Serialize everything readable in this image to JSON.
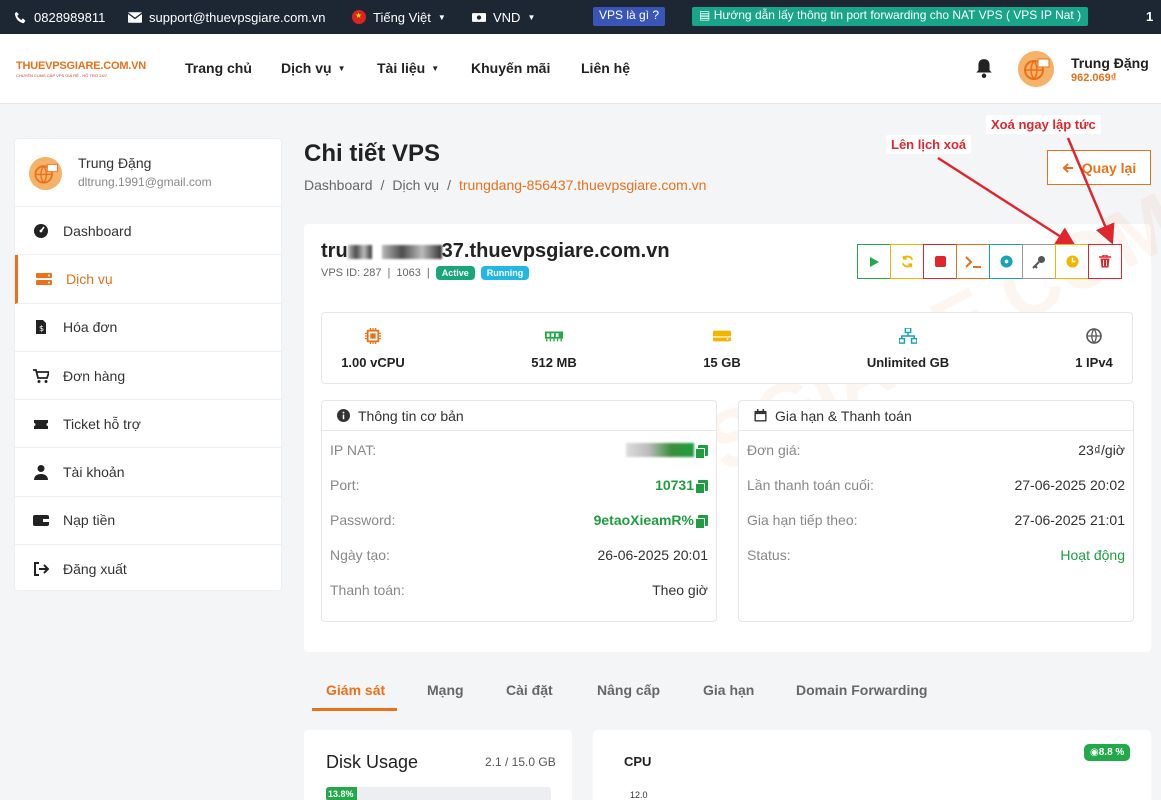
{
  "topbar": {
    "phone": "0828989811",
    "email": "support@thuevpsgiare.com.vn",
    "language": "Tiếng Việt",
    "currency": "VND",
    "vps_link": "VPS là gì ?",
    "guide_link": "Hướng dẫn lấy thông tin port forwarding cho NAT VPS ( VPS IP Nat )",
    "trailing": "1"
  },
  "header": {
    "logo_text": "THUEVPSGIARE.COM.VN",
    "logo_tagline": "CHUYÊN CUNG CẤP VPS GIÁ RẺ - HỖ TRỢ 24/7",
    "nav": [
      "Trang chủ",
      "Dịch vụ",
      "Tài liệu",
      "Khuyến mãi",
      "Liên hệ"
    ],
    "user_name": "Trung Đặng",
    "user_balance": "962.069₫"
  },
  "sidebar": {
    "user_name": "Trung Đặng",
    "user_email": "dltrung.1991@gmail.com",
    "items": [
      {
        "label": "Dashboard",
        "icon": "dashboard-icon"
      },
      {
        "label": "Dịch vụ",
        "icon": "server-icon"
      },
      {
        "label": "Hóa đơn",
        "icon": "invoice-icon"
      },
      {
        "label": "Đơn hàng",
        "icon": "cart-icon"
      },
      {
        "label": "Ticket hỗ trợ",
        "icon": "ticket-icon"
      },
      {
        "label": "Tài khoản",
        "icon": "user-icon"
      },
      {
        "label": "Nạp tiền",
        "icon": "wallet-icon"
      },
      {
        "label": "Đăng xuất",
        "icon": "logout-icon"
      }
    ],
    "active_index": 1
  },
  "page": {
    "title": "Chi tiết VPS",
    "breadcrumb": [
      "Dashboard",
      "Dịch vụ",
      "trungdang-856437.thuevpsgiare.com.vn"
    ],
    "back_label": "Quay lại",
    "annotation_schedule": "Lên lịch xoá",
    "annotation_delete": "Xoá ngay lập tức"
  },
  "vps": {
    "host_visible_start": "tru",
    "host_visible_end": "37.thuevpsgiare.com.vn",
    "vps_id": "VPS ID: 287",
    "plan_id": "1063",
    "status_active": "Active",
    "status_running": "Running",
    "actions": [
      {
        "name": "start",
        "icon": "play-icon",
        "color": "#22a94a"
      },
      {
        "name": "restart",
        "icon": "refresh-icon",
        "color": "#f2b600"
      },
      {
        "name": "stop",
        "icon": "stop-icon",
        "color": "#e0262d"
      },
      {
        "name": "console",
        "icon": "terminal-icon",
        "color": "#e8711a"
      },
      {
        "name": "reinstall",
        "icon": "disc-icon",
        "color": "#17a2b8"
      },
      {
        "name": "password",
        "icon": "key-icon",
        "color": "#555555"
      },
      {
        "name": "schedule-delete",
        "icon": "clock-icon",
        "color": "#f2b600"
      },
      {
        "name": "delete",
        "icon": "trash-icon",
        "color": "#e0262d"
      }
    ]
  },
  "specs": [
    {
      "label": "1.00 vCPU",
      "icon": "cpu-icon",
      "color": "#e8711a"
    },
    {
      "label": "512 MB",
      "icon": "ram-icon",
      "color": "#22a94a"
    },
    {
      "label": "15 GB",
      "icon": "disk-icon",
      "color": "#f2b600"
    },
    {
      "label": "Unlimited GB",
      "icon": "network-icon",
      "color": "#17a2b8"
    },
    {
      "label": "1 IPv4",
      "icon": "globe-icon",
      "color": "#555555"
    }
  ],
  "basic_info": {
    "title": "Thông tin cơ bản",
    "rows": [
      {
        "label": "IP NAT:",
        "value": ""
      },
      {
        "label": "Port:",
        "value": "10731"
      },
      {
        "label": "Password:",
        "value": "9etaoXieamR%"
      },
      {
        "label": "Ngày tạo:",
        "value": "26-06-2025 20:01"
      },
      {
        "label": "Thanh toán:",
        "value": "Theo giờ"
      }
    ]
  },
  "billing": {
    "title": "Gia hạn & Thanh toán",
    "rows": [
      {
        "label": "Đơn giá:",
        "value": "23₫/giờ"
      },
      {
        "label": "Lần thanh toán cuối:",
        "value": "27-06-2025 20:02"
      },
      {
        "label": "Gia hạn tiếp theo:",
        "value": "27-06-2025 21:01"
      },
      {
        "label": "Status:",
        "value": "Hoạt động"
      }
    ]
  },
  "tabs": [
    "Giám sát",
    "Mạng",
    "Cài đặt",
    "Nâng cấp",
    "Gia hạn",
    "Domain Forwarding"
  ],
  "monitor": {
    "disk_title": "Disk Usage",
    "disk_value": "2.1 / 15.0 GB",
    "disk_percent_label": "13.8%",
    "disk_percent": 13.8,
    "cpu_title": "CPU",
    "cpu_badge": "8.8 %",
    "cpu_first_tick": "12.0"
  }
}
